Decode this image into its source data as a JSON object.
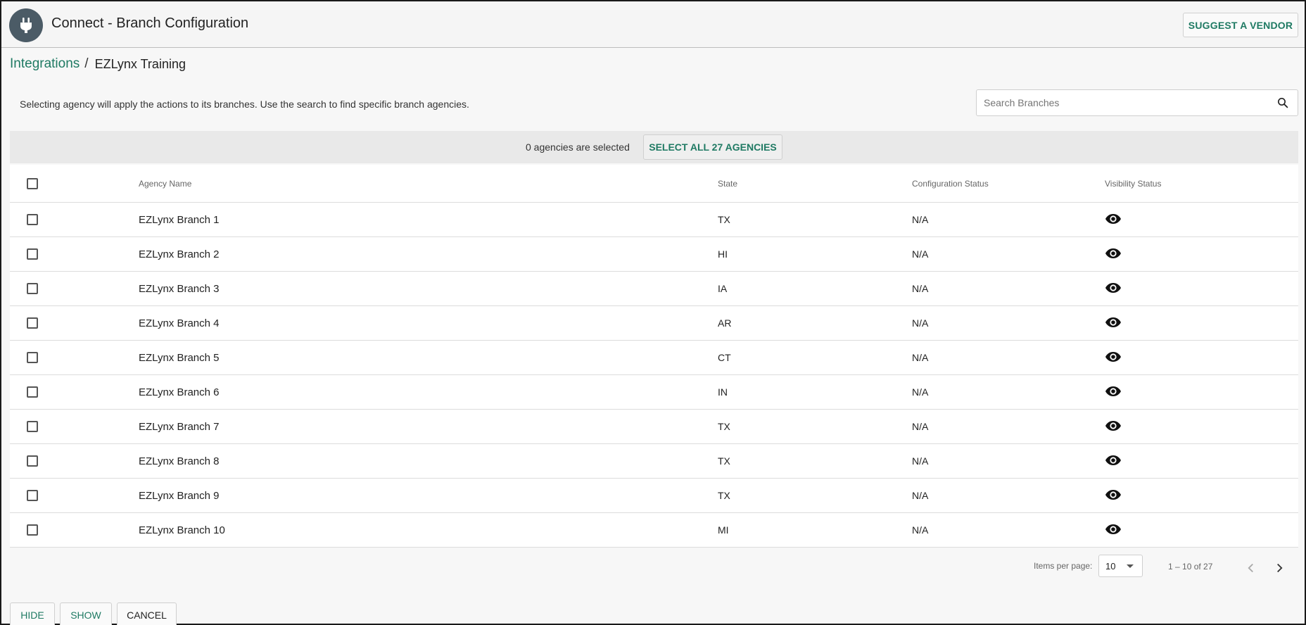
{
  "header": {
    "title": "Connect - Branch Configuration",
    "suggest_label": "SUGGEST A VENDOR",
    "logo_icon": "plug-icon"
  },
  "breadcrumb": {
    "root": "Integrations",
    "separator": "/",
    "current": "EZLynx Training"
  },
  "instruction": "Selecting agency will apply the actions to its branches. Use the search to find specific branch agencies.",
  "search": {
    "placeholder": "Search Branches",
    "value": "",
    "icon": "search-icon"
  },
  "selection": {
    "count_text": "0 agencies are selected",
    "select_all_label": "SELECT ALL 27 AGENCIES"
  },
  "table": {
    "columns": [
      "Agency Name",
      "State",
      "Configuration Status",
      "Visibility Status"
    ],
    "rows": [
      {
        "name": "EZLynx Branch 1",
        "state": "TX",
        "config": "N/A",
        "visibility": "visible"
      },
      {
        "name": "EZLynx Branch 2",
        "state": "HI",
        "config": "N/A",
        "visibility": "visible"
      },
      {
        "name": "EZLynx Branch 3",
        "state": "IA",
        "config": "N/A",
        "visibility": "visible"
      },
      {
        "name": "EZLynx Branch 4",
        "state": "AR",
        "config": "N/A",
        "visibility": "visible"
      },
      {
        "name": "EZLynx Branch 5",
        "state": "CT",
        "config": "N/A",
        "visibility": "visible"
      },
      {
        "name": "EZLynx Branch 6",
        "state": "IN",
        "config": "N/A",
        "visibility": "visible"
      },
      {
        "name": "EZLynx Branch 7",
        "state": "TX",
        "config": "N/A",
        "visibility": "visible"
      },
      {
        "name": "EZLynx Branch 8",
        "state": "TX",
        "config": "N/A",
        "visibility": "visible"
      },
      {
        "name": "EZLynx Branch 9",
        "state": "TX",
        "config": "N/A",
        "visibility": "visible"
      },
      {
        "name": "EZLynx Branch 10",
        "state": "MI",
        "config": "N/A",
        "visibility": "visible"
      }
    ]
  },
  "paginator": {
    "items_per_page_label": "Items per page:",
    "items_per_page": "10",
    "range": "1 – 10 of 27"
  },
  "footer": {
    "hide_label": "HIDE",
    "show_label": "SHOW",
    "cancel_label": "CANCEL"
  },
  "colors": {
    "accent": "#1f7a63",
    "logo_bg": "#4b5b66",
    "header_bg": "#f5f5f5",
    "select_bar_bg": "#e9e9e9"
  }
}
